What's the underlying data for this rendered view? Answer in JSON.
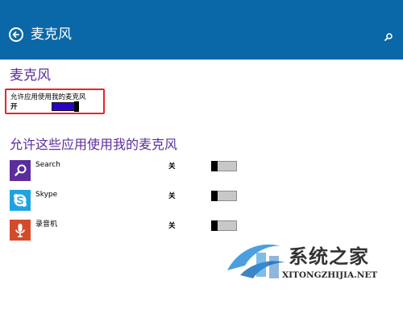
{
  "header": {
    "title": "麦克风",
    "background": "#0a67a8",
    "back_icon": "back-arrow-icon",
    "search_icon": "search-icon"
  },
  "section": {
    "title": "麦克风",
    "master_toggle": {
      "label": "允许应用使用我的麦克风",
      "state": "开",
      "on": true,
      "color": "#2b00c8"
    }
  },
  "apps_section": {
    "title": "允许这些应用使用我的麦克风",
    "apps": [
      {
        "name": "Search",
        "state": "关",
        "on": false,
        "icon": "search-icon",
        "tile_color": "#5b2d9e"
      },
      {
        "name": "Skype",
        "state": "关",
        "on": false,
        "icon": "skype-icon",
        "tile_color": "#1ea3e2"
      },
      {
        "name": "录音机",
        "state": "关",
        "on": false,
        "icon": "microphone-icon",
        "tile_color": "#d34b2a"
      }
    ]
  },
  "highlight_color": "#e8242c",
  "watermark": {
    "text": "系统之家",
    "url": "XITONGZHIJIA.NET"
  }
}
